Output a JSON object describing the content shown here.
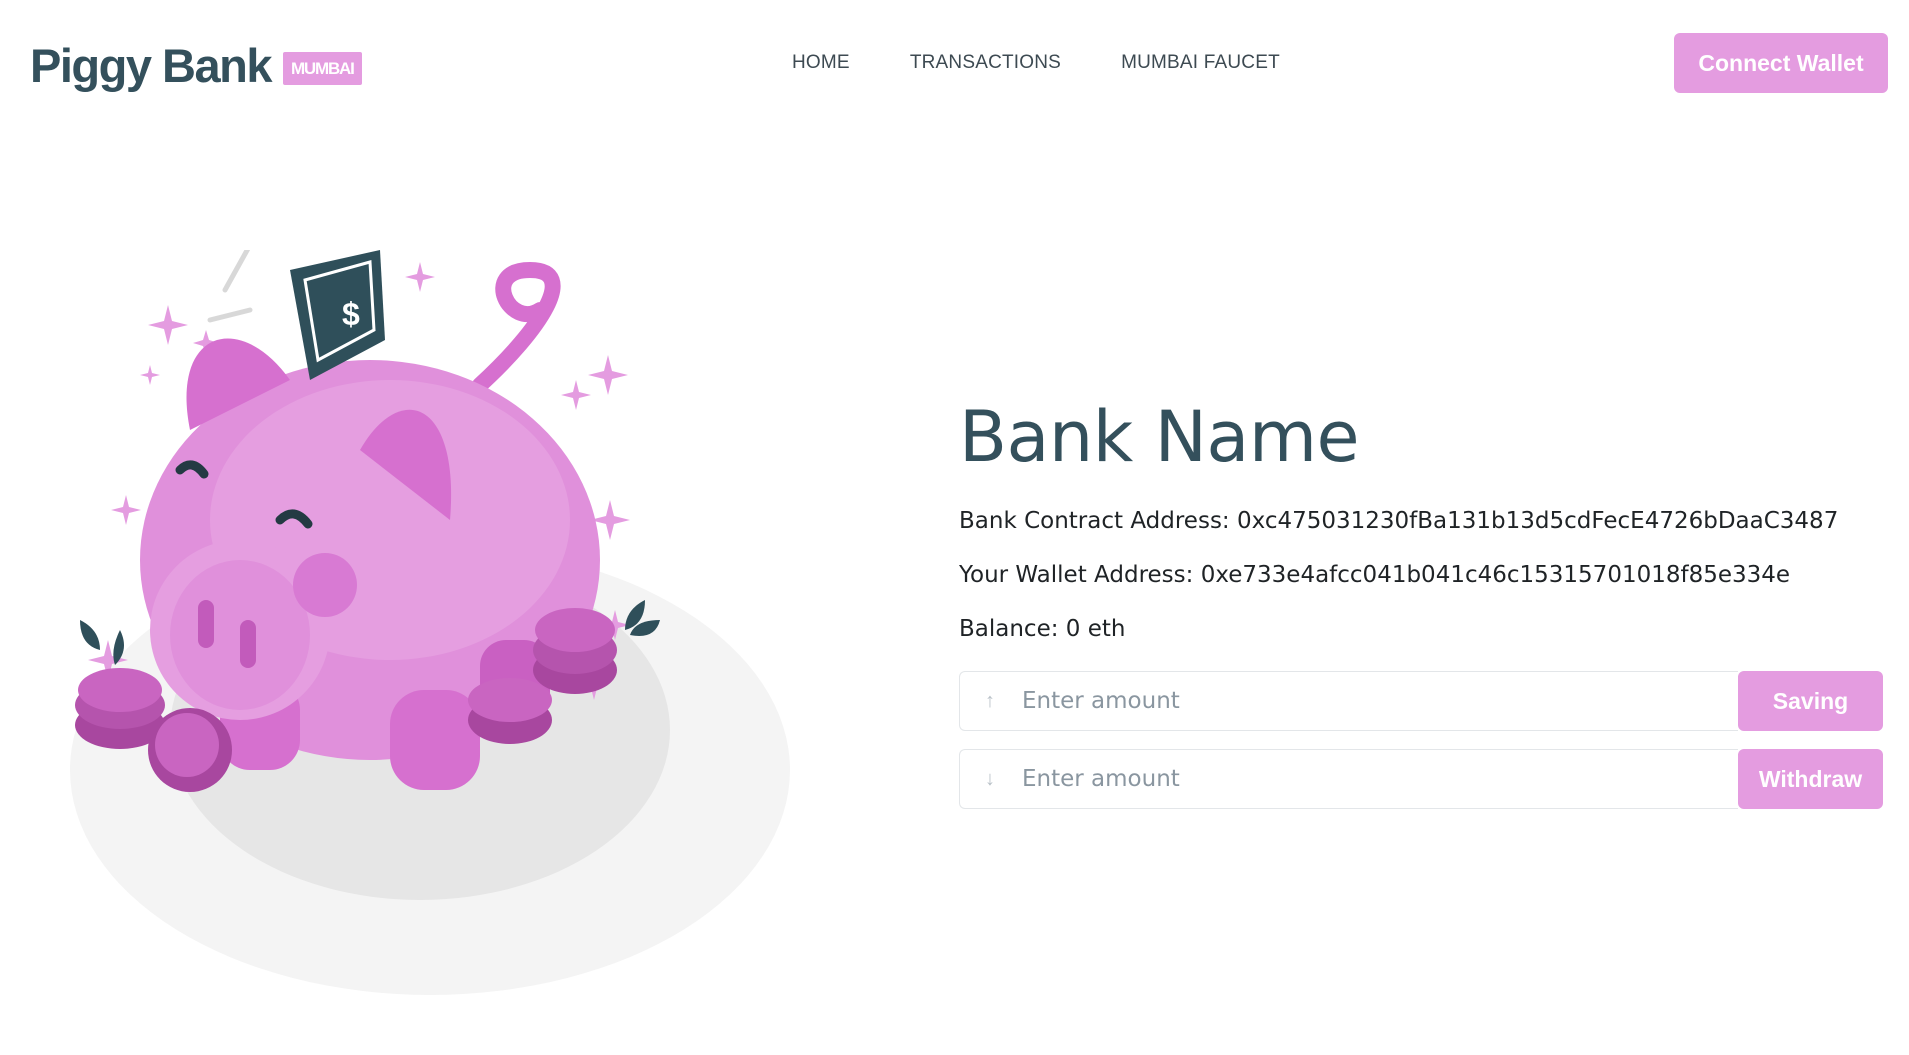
{
  "brand": {
    "title": "Piggy Bank",
    "badge": "MUMBAI"
  },
  "nav": {
    "links": [
      "HOME",
      "TRANSACTIONS",
      "MUMBAI FAUCET"
    ]
  },
  "header": {
    "connect_label": "Connect Wallet"
  },
  "bank": {
    "name": "Bank Name",
    "contract_label": "Bank Contract Address: ",
    "contract_address": "0xc475031230fBa131b13d5cdFecE4726bDaaC3487",
    "wallet_label": "Your Wallet Address: ",
    "wallet_address": "0xe733e4afcc041b041c46c15315701018f85e334e",
    "balance_label": "Balance: ",
    "balance_value": "0 eth"
  },
  "forms": {
    "deposit": {
      "placeholder": "Enter amount",
      "button": "Saving",
      "icon": "arrow-up-icon"
    },
    "withdraw": {
      "placeholder": "Enter amount",
      "button": "Withdraw",
      "icon": "arrow-down-icon"
    }
  },
  "colors": {
    "accent": "#e49ce0",
    "brand_text": "#34505c"
  }
}
